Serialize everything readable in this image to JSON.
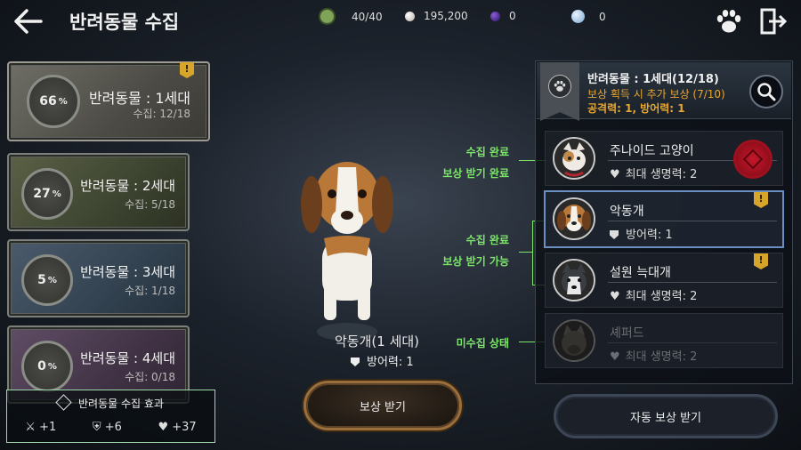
{
  "header": {
    "title": "반려동물 수집",
    "back_icon": "back-arrow-icon",
    "resources": [
      {
        "icon": "energy-icon",
        "value": "40/40",
        "color": "#7fa35a"
      },
      {
        "icon": "silver-coin-icon",
        "value": "195,200",
        "color": "#c8c0b8"
      },
      {
        "icon": "purple-gem-icon",
        "value": "0",
        "color": "#5b2fa8"
      },
      {
        "icon": "blue-coin-icon",
        "value": "0",
        "color": "#9fc4e6"
      }
    ],
    "paw_icon": "paw-icon",
    "exit_icon": "exit-door-icon"
  },
  "generations": [
    {
      "name": "반려동물 : 1세대",
      "percent": "66",
      "percent_unit": "%",
      "count": "수집: 12/18",
      "alert": "!"
    },
    {
      "name": "반려동물 : 2세대",
      "percent": "27",
      "percent_unit": "%",
      "count": "수집: 5/18"
    },
    {
      "name": "반려동물 : 3세대",
      "percent": "5",
      "percent_unit": "%",
      "count": "수집: 1/18"
    },
    {
      "name": "반려동물 : 4세대",
      "percent": "0",
      "percent_unit": "%",
      "count": "수집: 0/18"
    }
  ],
  "effect": {
    "title": "반려동물 수집 효과",
    "stats": [
      {
        "icon": "swords-icon",
        "value": "+1"
      },
      {
        "icon": "shield-icon",
        "value": "+6"
      },
      {
        "icon": "heart-icon",
        "value": "+37"
      }
    ]
  },
  "center": {
    "pet_name": "악동개(1 세대)",
    "pet_stat": "방어력: 1",
    "claim_button": "보상 받기"
  },
  "annotations": {
    "completed": "수집 완료",
    "reward_done": "보상 받기 완료",
    "completed2": "수집 완료",
    "reward_available": "보상 받기 가능",
    "not_collected": "미수집 상태"
  },
  "panel": {
    "title": "반려동물 : 1세대(12/18)",
    "bonus": "보상 획득 시 추가 보상 (7/10)",
    "stat": "공격력: 1, 방어력: 1",
    "pets": [
      {
        "name": "주나이드 고양이",
        "stat": "최대 생명력: 2",
        "stat_icon": "heart-icon",
        "state": "claimed"
      },
      {
        "name": "악동개",
        "stat": "방어력: 1",
        "stat_icon": "shield-icon",
        "state": "claimable",
        "alert": "!"
      },
      {
        "name": "설원 늑대개",
        "stat": "최대 생명력: 2",
        "stat_icon": "heart-icon",
        "state": "claimable",
        "alert": "!"
      },
      {
        "name": "셰퍼드",
        "stat": "최대 생명력: 2",
        "stat_icon": "heart-icon",
        "state": "uncollected"
      }
    ],
    "auto_button": "자동 보상 받기"
  }
}
